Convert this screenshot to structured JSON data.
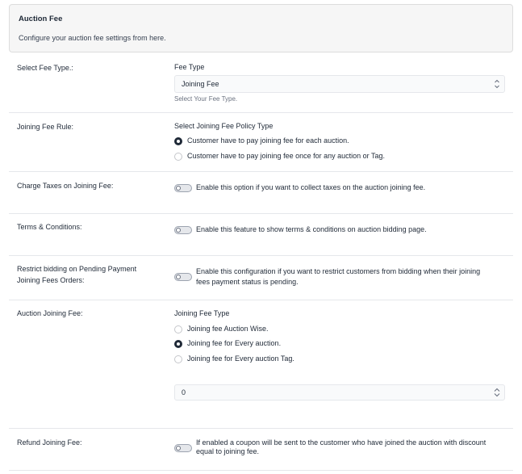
{
  "header": {
    "title": "Auction Fee",
    "description": "Configure your auction fee settings from here."
  },
  "fee_type": {
    "label": "Select Fee Type.:",
    "field_label": "Fee Type",
    "selected": "Joining Fee",
    "help": "Select Your Fee Type."
  },
  "joining_fee_rule": {
    "label": "Joining Fee Rule:",
    "field_label": "Select Joining Fee Policy Type",
    "options": [
      {
        "text": "Customer have to pay joining fee for each auction.",
        "checked": true
      },
      {
        "text": "Customer have to pay joining fee once for any auction or Tag.",
        "checked": false
      }
    ]
  },
  "charge_taxes": {
    "label": "Charge Taxes on Joining Fee:",
    "enabled": false,
    "text": "Enable this option if you want to collect taxes on the auction joining fee."
  },
  "terms": {
    "label": "Terms & Conditions:",
    "enabled": false,
    "text": "Enable this feature to show terms & conditions on auction bidding page."
  },
  "restrict_bidding": {
    "label_line1": "Restrict bidding on Pending Payment",
    "label_line2": "Joining Fees Orders:",
    "enabled": false,
    "text_line1": "Enable this configuration if you want to restrict customers from bidding when their joining",
    "text_line2": "fees payment status is pending."
  },
  "auction_joining_fee": {
    "label": "Auction Joining Fee:",
    "field_label": "Joining Fee Type",
    "options": [
      {
        "text": "Joining fee Auction Wise.",
        "checked": false
      },
      {
        "text": "Joining fee for Every auction.",
        "checked": true
      },
      {
        "text": "Joining fee for Every auction Tag.",
        "checked": false
      }
    ],
    "amount": "0"
  },
  "refund": {
    "label": "Refund Joining Fee:",
    "enabled": false,
    "text_line1": "If enabled a coupon will be sent to the customer who have joined the auction with discount",
    "text_line2": "equal to joining fee."
  },
  "icons": {
    "select_arrow": "chevron-up-down-icon",
    "spinner": "number-spinner-icon"
  }
}
